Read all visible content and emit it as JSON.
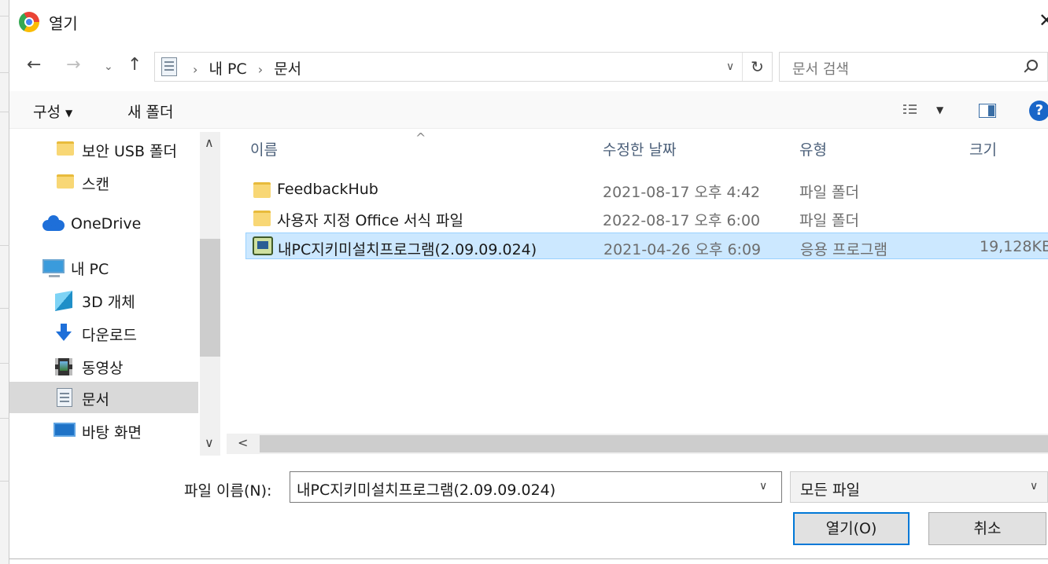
{
  "window": {
    "title": "열기"
  },
  "address": {
    "crumbs": [
      "내 PC",
      "문서"
    ]
  },
  "search": {
    "placeholder": "문서 검색"
  },
  "commands": {
    "organize": "구성",
    "new_folder": "새 폴더"
  },
  "sidebar": {
    "items": [
      {
        "label": "보안 USB 폴더",
        "icon": "folder-icon"
      },
      {
        "label": "스캔",
        "icon": "folder-icon"
      },
      {
        "label": "OneDrive",
        "icon": "cloud-icon"
      },
      {
        "label": "내 PC",
        "icon": "computer-icon"
      },
      {
        "label": "3D 개체",
        "icon": "cube-icon"
      },
      {
        "label": "다운로드",
        "icon": "download-arrow-icon"
      },
      {
        "label": "동영상",
        "icon": "film-icon"
      },
      {
        "label": "문서",
        "icon": "document-icon",
        "selected": true
      },
      {
        "label": "바탕 화면",
        "icon": "desktop-icon"
      }
    ]
  },
  "columns": {
    "name": "이름",
    "modified": "수정한 날짜",
    "type": "유형",
    "size": "크기"
  },
  "files": [
    {
      "name": "FeedbackHub",
      "modified": "2021-08-17 오후 4:42",
      "type": "파일 폴더",
      "size": "",
      "icon": "folder-icon"
    },
    {
      "name": "사용자 지정 Office 서식 파일",
      "modified": "2022-08-17 오후 6:00",
      "type": "파일 폴더",
      "size": "",
      "icon": "folder-icon"
    },
    {
      "name": "내PC지키미설치프로그램(2.09.09.024)",
      "modified": "2021-04-26 오후 6:09",
      "type": "응용 프로그램",
      "size": "19,128KB",
      "icon": "application-icon",
      "selected": true
    }
  ],
  "bottom": {
    "filename_label": "파일 이름(N):",
    "filename_value": "내PC지키미설치프로그램(2.09.09.024)",
    "filetype_value": "모든 파일",
    "open_label": "열기(O)",
    "cancel_label": "취소"
  },
  "colors": {
    "selection": "#cce8ff",
    "accent": "#0078d7",
    "help": "#1a66c8"
  }
}
